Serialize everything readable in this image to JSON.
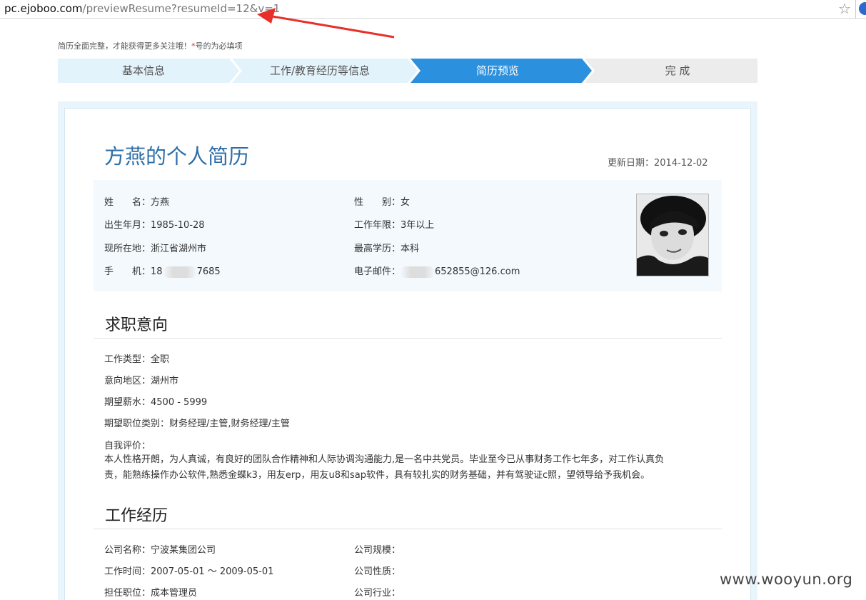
{
  "browser": {
    "url_host": "pc.ejoboo.com",
    "url_path": "/previewResume?resumeId=12&v=1",
    "star_icon": "☆"
  },
  "hint": {
    "text": "简历全面完整，才能获得更多关注哦！",
    "required_mark": "*",
    "required_text": "号的为必填项"
  },
  "steps": [
    {
      "label": "基本信息",
      "state": "done"
    },
    {
      "label": "工作/教育经历等信息",
      "state": "done"
    },
    {
      "label": "简历预览",
      "state": "active"
    },
    {
      "label": "完 成",
      "state": "pending"
    }
  ],
  "colors": {
    "step_done": "#e3f3fb",
    "step_active": "#2b90dd",
    "step_pending": "#ececec",
    "title": "#2f6fa8",
    "annotation_arrow": "#e8302a"
  },
  "resume": {
    "title": "方燕的个人简历",
    "updated_label": "更新日期：",
    "updated_date": "2014-12-02",
    "basic": {
      "name_label": "姓　　名：",
      "name": "方燕",
      "gender_label": "性　　别：",
      "gender": "女",
      "birth_label": "出生年月：",
      "birth": "1985-10-28",
      "years_label": "工作年限：",
      "years": "3年以上",
      "location_label": "现所在地：",
      "location": "浙江省湖州市",
      "education_label": "最高学历：",
      "education": "本科",
      "phone_label": "手　　机：",
      "phone_prefix": "18",
      "phone_suffix": "7685",
      "email_label": "电子邮件：",
      "email_suffix": "652855@126.com"
    },
    "intent": {
      "heading": "求职意向",
      "type_label": "工作类型：",
      "type": "全职",
      "area_label": "意向地区：",
      "area": "湖州市",
      "salary_label": "期望薪水：",
      "salary": "4500 - 5999",
      "category_label": "期望职位类别：",
      "category": "财务经理/主管,财务经理/主管",
      "self_label": "自我评价：",
      "self_line1": "本人性格开朗，为人真诚，有良好的团队合作精神和人际协调沟通能力,是一名中共党员。毕业至今已从事财务工作七年多，对工作认真负",
      "self_line2": "责，能熟练操作办公软件,熟悉金蝶k3，用友erp，用友u8和sap软件，具有较扎实的财务基础，并有驾驶证c照，望领导给予我机会。"
    },
    "work": {
      "heading": "工作经历",
      "company_label": "公司名称：",
      "company": "宁波某集团公司",
      "size_label": "公司规模：",
      "size": "",
      "period_label": "工作时间：",
      "period": "2007-05-01 ～ 2009-05-01",
      "nature_label": "公司性质：",
      "nature": "",
      "position_label": "担任职位：",
      "position": "成本管理员",
      "industry_label": "公司行业：",
      "industry": ""
    }
  },
  "watermark": "www.wooyun.org"
}
